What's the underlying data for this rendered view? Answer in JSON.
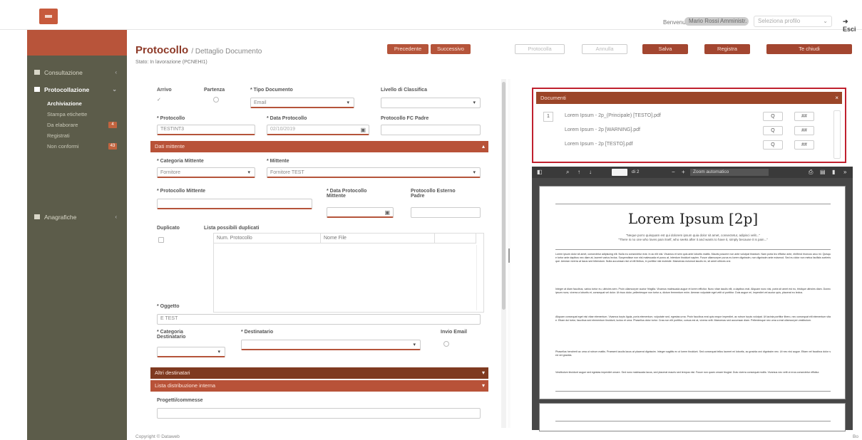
{
  "header": {
    "welcome": "Benvenuto",
    "username": "Mario Rossi Amministr.",
    "profile_placeholder": "Seleziona profilo",
    "logout": "Esci"
  },
  "sidebar": {
    "items": [
      {
        "label": "Consultazione",
        "arrow": "‹"
      },
      {
        "label": "Protocollazione",
        "arrow": "⌄"
      },
      {
        "label": "Anagrafiche",
        "arrow": "‹"
      }
    ],
    "sub": [
      {
        "label": "Archiviazione",
        "badge": ""
      },
      {
        "label": "Stampa etichette",
        "badge": ""
      },
      {
        "label": "Da elaborare",
        "badge": "4"
      },
      {
        "label": "Registrati",
        "badge": ""
      },
      {
        "label": "Non conformi",
        "badge": "43"
      }
    ]
  },
  "page": {
    "title": "Protocollo",
    "subtitle": "/ Dettaglio Documento",
    "state": "Stato: In lavorazione (PCNEHI1)"
  },
  "actions": {
    "prev": "Precedente",
    "next": "Successivo",
    "protocol": "Protocolla",
    "annul": "Annulla",
    "save": "Salva",
    "register": "Registra",
    "close": "Te chiudi"
  },
  "form": {
    "arrivo": "Arrivo",
    "partenza": "Partenza",
    "tipo_doc_label": "* Tipo Documento",
    "tipo_doc_value": "Email",
    "livello_label": "Livello di Classifica",
    "protocollo_label": "* Protocollo",
    "protocollo_value": "TESTINT3",
    "data_prot_label": "* Data Protocollo",
    "data_prot_value": "02/10/2019",
    "prot_fc_label": "Protocollo FC Padre",
    "dati_mittente": "Dati mittente",
    "cat_mitt_label": "* Categoria Mittente",
    "cat_mitt_value": "Fornitore",
    "mittente_label": "* Mittente",
    "mittente_value": "Fornitore TEST",
    "prot_mitt_label": "* Protocollo Mittente",
    "data_prot_mitt_label": "* Data Protocollo Mittente",
    "prot_esterno_label": "Protocollo Esterno Padre",
    "duplicato_label": "Duplicato",
    "lista_dup_label": "Lista possibili duplicati",
    "col_num": "Num. Protocollo",
    "col_file": "Nome File",
    "oggetto_label": "* Oggetto",
    "oggetto_value": "E TEST",
    "cat_dest_label": "* Categoria Destinatario",
    "destinatario_label": "* Destinatario",
    "invio_email_label": "Invio Email",
    "altri_destinatari": "Altri destinatari",
    "lista_distribuzione": "Lista distribuzione interna",
    "progetti_label": "Progetti/commesse"
  },
  "documents": {
    "title": "Documenti",
    "rows": [
      {
        "idx": "1",
        "name": "Lorem Ipsum - 2p_(Principale) [TESTO].pdf"
      },
      {
        "idx": "",
        "name": "Lorem Ipsum - 2p [WARNING].pdf"
      },
      {
        "idx": "",
        "name": "Lorem Ipsum - 2p [TESTO].pdf"
      }
    ],
    "view_icon": "Q",
    "action": "##"
  },
  "viewer": {
    "page_of": "di 2",
    "zoom": "Zoom automatico",
    "pdf_title": "Lorem Ipsum [2p]",
    "pdf_sub1": "\"Neque porro quisquam est qui dolorem ipsum quia dolor sit amet, consectetur, adipisci velit...\"",
    "pdf_sub2": "\"There is no one who loves pain itself, who seeks after it and wants to have it, simply because it is pain...\"",
    "para1": "Lorem ipsum dolor sit amet, consectetur adipiscing elit. Nulla eu consectetur erat. In ac elit nisl. Vivamus et sem quis ante lobortis mattis. Mauris posuere non ante volutpat tincidunt. Nam porta leo efficitur ante, eleifend rhoncus arcu mi. Quisque tortor ante dapibus nec diam at, laoreet varius lectus. Suspendisse non nisl malesuada et purus at, interdum tincidunt sapien. Fusce ullamcorper purus eu lorem dignissim, non dignissim ante euismod. Sed eu dolor non metus facilisis scelerisque. Aenean viverra at lacus sed bibendum. Nulla accumsan nisl ut elit finibus, in porttitor nisl molestie. Maecenas euismod iaculis ex, sit amet ultrices orci.",
    "para2": "Integer at diam faucibus, varius tortor eu, ultricies sem. Proin ullamcorper auctor fringilla. Vivamus malesuada augue et lorem efficitur. Nunc vitae iaculis elit, a dapibus erat. Aliquam nunc nisi, porta sit amet est eu, tristique ultricies diam. Donec ipsum nunc, viverra a lobortis et, consequat vel dolor. Ut risus dolor, pellentesque non tortor a, dictum fermentum enim. Aenean vulputate eget velit ut porttitor. Duis augue mi, imperdiet vel auctor quis, placerat eu lectus.",
    "para3": "Aliquam consequat eget nisi vitae elementum. Vivamus turpis ligula, porta elementum, vulputate sed, egestas urna. Proin faucibus erat quis neque imperdiet, ac rutrum turpis volutpat. Ut lacinia porttitor libero, nec consequat elit elementum vitae. Etiam dui tortor, faucibus sed elementum tincidunt, luctus et urna. Phasellus dolor tortor. Cras non elit porttitor, cursus est at, viverra velit. Maecenas sed accumsan diam. Pellentesque nec urna a erat ullamcorper vestibulum.",
    "para4": "Phasellus hendrerit ac urna ut rutrum mattis. Praesent iaculis lacus at placerat dignissim. Integer sagittis ex ut lorem tincidunt. Sed consequat tellus laoreet mi lobortis, ac gravida orci dignissim nec. Ut nec nisi augue. Etiam vel faucibus dolor sed vel gravida.",
    "para5": "Vestibulum tincidunt augue sed egestas imperdiet ornare. Sed nunc malesuada lacus, sed placerat mauris sed tempus nisi. Fusce non quam ornare feugiat. Duis viverra consequat mollis. Vivamus nec velit ut eros consectetur efficitur."
  },
  "footer": {
    "copyright": "Copyright © Dataweb",
    "right": "Bo"
  },
  "colors": {
    "brand": "#b5543a",
    "sidebar": "#5c5c4a",
    "highlight": "#c0202e"
  }
}
